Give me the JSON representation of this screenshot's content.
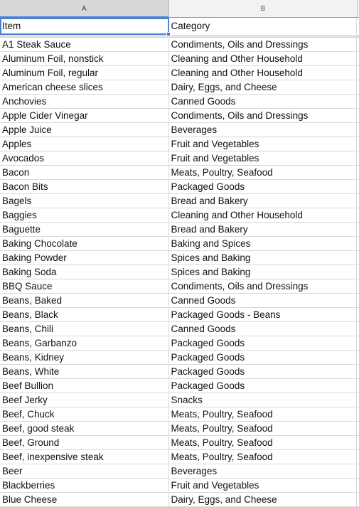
{
  "app": {
    "type": "spreadsheet"
  },
  "colors": {
    "selection": "#4a82d4",
    "active_header_bg": "#d8d8d8",
    "header_bg": "#f2f2f2",
    "gridline": "#d9d9d9",
    "text": "#111111"
  },
  "column_headers": [
    {
      "label": "A",
      "active": true
    },
    {
      "label": "B",
      "active": false
    }
  ],
  "selected_cell": "A1",
  "table": {
    "headers": [
      "Item",
      "Category"
    ],
    "rows": [
      [
        "A1 Steak Sauce",
        "Condiments, Oils and Dressings"
      ],
      [
        "Aluminum Foil, nonstick",
        "Cleaning and Other Household"
      ],
      [
        "Aluminum Foil, regular",
        "Cleaning and Other Household"
      ],
      [
        "American cheese slices",
        "Dairy, Eggs, and Cheese"
      ],
      [
        "Anchovies",
        "Canned Goods"
      ],
      [
        "Apple Cider Vinegar",
        "Condiments, Oils and Dressings"
      ],
      [
        "Apple Juice",
        "Beverages"
      ],
      [
        "Apples",
        "Fruit and Vegetables"
      ],
      [
        "Avocados",
        "Fruit and Vegetables"
      ],
      [
        "Bacon",
        "Meats, Poultry, Seafood"
      ],
      [
        "Bacon Bits",
        "Packaged Goods"
      ],
      [
        "Bagels",
        "Bread and Bakery"
      ],
      [
        "Baggies",
        "Cleaning and Other Household"
      ],
      [
        "Baguette",
        "Bread and Bakery"
      ],
      [
        "Baking Chocolate",
        "Baking and Spices"
      ],
      [
        "Baking Powder",
        "Spices and Baking"
      ],
      [
        "Baking Soda",
        "Spices and Baking"
      ],
      [
        "BBQ Sauce",
        "Condiments, Oils and Dressings"
      ],
      [
        "Beans, Baked",
        "Canned Goods"
      ],
      [
        "Beans, Black",
        "Packaged Goods - Beans"
      ],
      [
        "Beans, Chili",
        "Canned Goods"
      ],
      [
        "Beans, Garbanzo",
        "Packaged Goods"
      ],
      [
        "Beans, Kidney",
        "Packaged Goods"
      ],
      [
        "Beans, White",
        "Packaged Goods"
      ],
      [
        "Beef Bullion",
        "Packaged Goods"
      ],
      [
        "Beef Jerky",
        "Snacks"
      ],
      [
        "Beef, Chuck",
        "Meats, Poultry, Seafood"
      ],
      [
        "Beef, good steak",
        "Meats, Poultry, Seafood"
      ],
      [
        "Beef, Ground",
        "Meats, Poultry, Seafood"
      ],
      [
        "Beef, inexpensive steak",
        "Meats, Poultry, Seafood"
      ],
      [
        "Beer",
        "Beverages"
      ],
      [
        "Blackberries",
        "Fruit and Vegetables"
      ],
      [
        "Blue Cheese",
        "Dairy, Eggs, and Cheese"
      ]
    ]
  }
}
